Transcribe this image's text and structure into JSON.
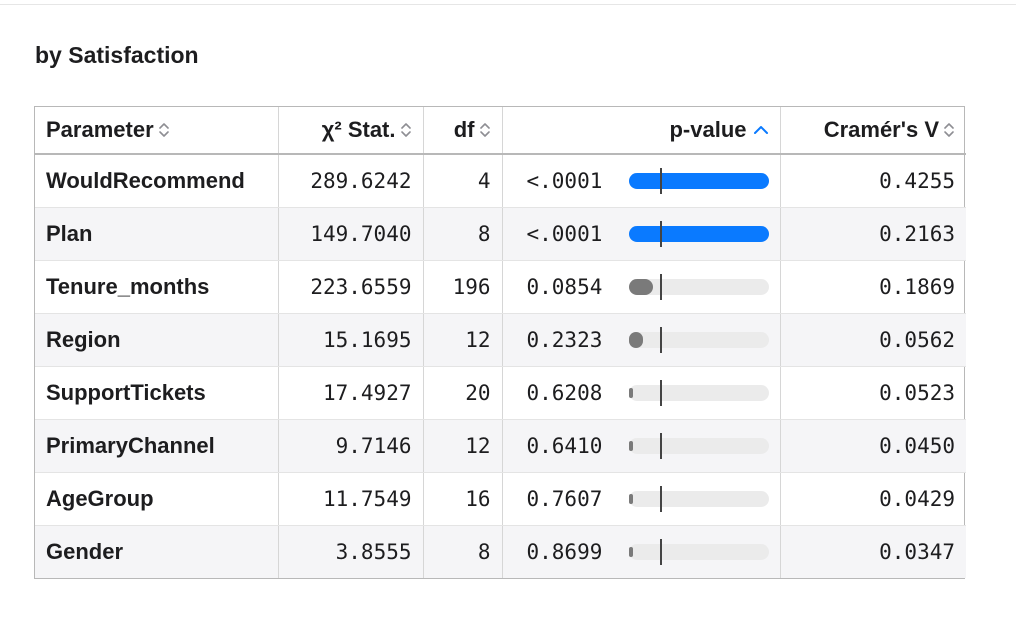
{
  "section": {
    "title": "by Satisfaction"
  },
  "table": {
    "columns": [
      {
        "key": "param",
        "label": "Parameter",
        "sort": "none"
      },
      {
        "key": "chi",
        "label": "χ² Stat.",
        "sort": "none"
      },
      {
        "key": "df",
        "label": "df",
        "sort": "none"
      },
      {
        "key": "p",
        "label": "p-value",
        "sort": "ascending"
      },
      {
        "key": "v",
        "label": "Cramér's V",
        "sort": "none"
      }
    ],
    "significance_threshold": 0.05,
    "rows": [
      {
        "param": "WouldRecommend",
        "chi": "289.6242",
        "df": "4",
        "p": "<.0001",
        "p_num": 0.0001,
        "v": "0.4255"
      },
      {
        "param": "Plan",
        "chi": "149.7040",
        "df": "8",
        "p": "<.0001",
        "p_num": 0.0001,
        "v": "0.2163"
      },
      {
        "param": "Tenure_months",
        "chi": "223.6559",
        "df": "196",
        "p": "0.0854",
        "p_num": 0.0854,
        "v": "0.1869"
      },
      {
        "param": "Region",
        "chi": "15.1695",
        "df": "12",
        "p": "0.2323",
        "p_num": 0.2323,
        "v": "0.0562"
      },
      {
        "param": "SupportTickets",
        "chi": "17.4927",
        "df": "20",
        "p": "0.6208",
        "p_num": 0.6208,
        "v": "0.0523"
      },
      {
        "param": "PrimaryChannel",
        "chi": "9.7146",
        "df": "12",
        "p": "0.6410",
        "p_num": 0.641,
        "v": "0.0450"
      },
      {
        "param": "AgeGroup",
        "chi": "11.7549",
        "df": "16",
        "p": "0.7607",
        "p_num": 0.7607,
        "v": "0.0429"
      },
      {
        "param": "Gender",
        "chi": "3.8555",
        "df": "8",
        "p": "0.8699",
        "p_num": 0.8699,
        "v": "0.0347"
      }
    ]
  },
  "colors": {
    "significant_bar": "#0a7aff",
    "nonsignificant_bar": "#7a7a7a",
    "sort_active": "#0a7aff",
    "sort_inactive": "#8e8e93"
  },
  "icons": {
    "sort_none": "sort-updown-icon",
    "sort_ascending": "chevron-up-icon"
  }
}
